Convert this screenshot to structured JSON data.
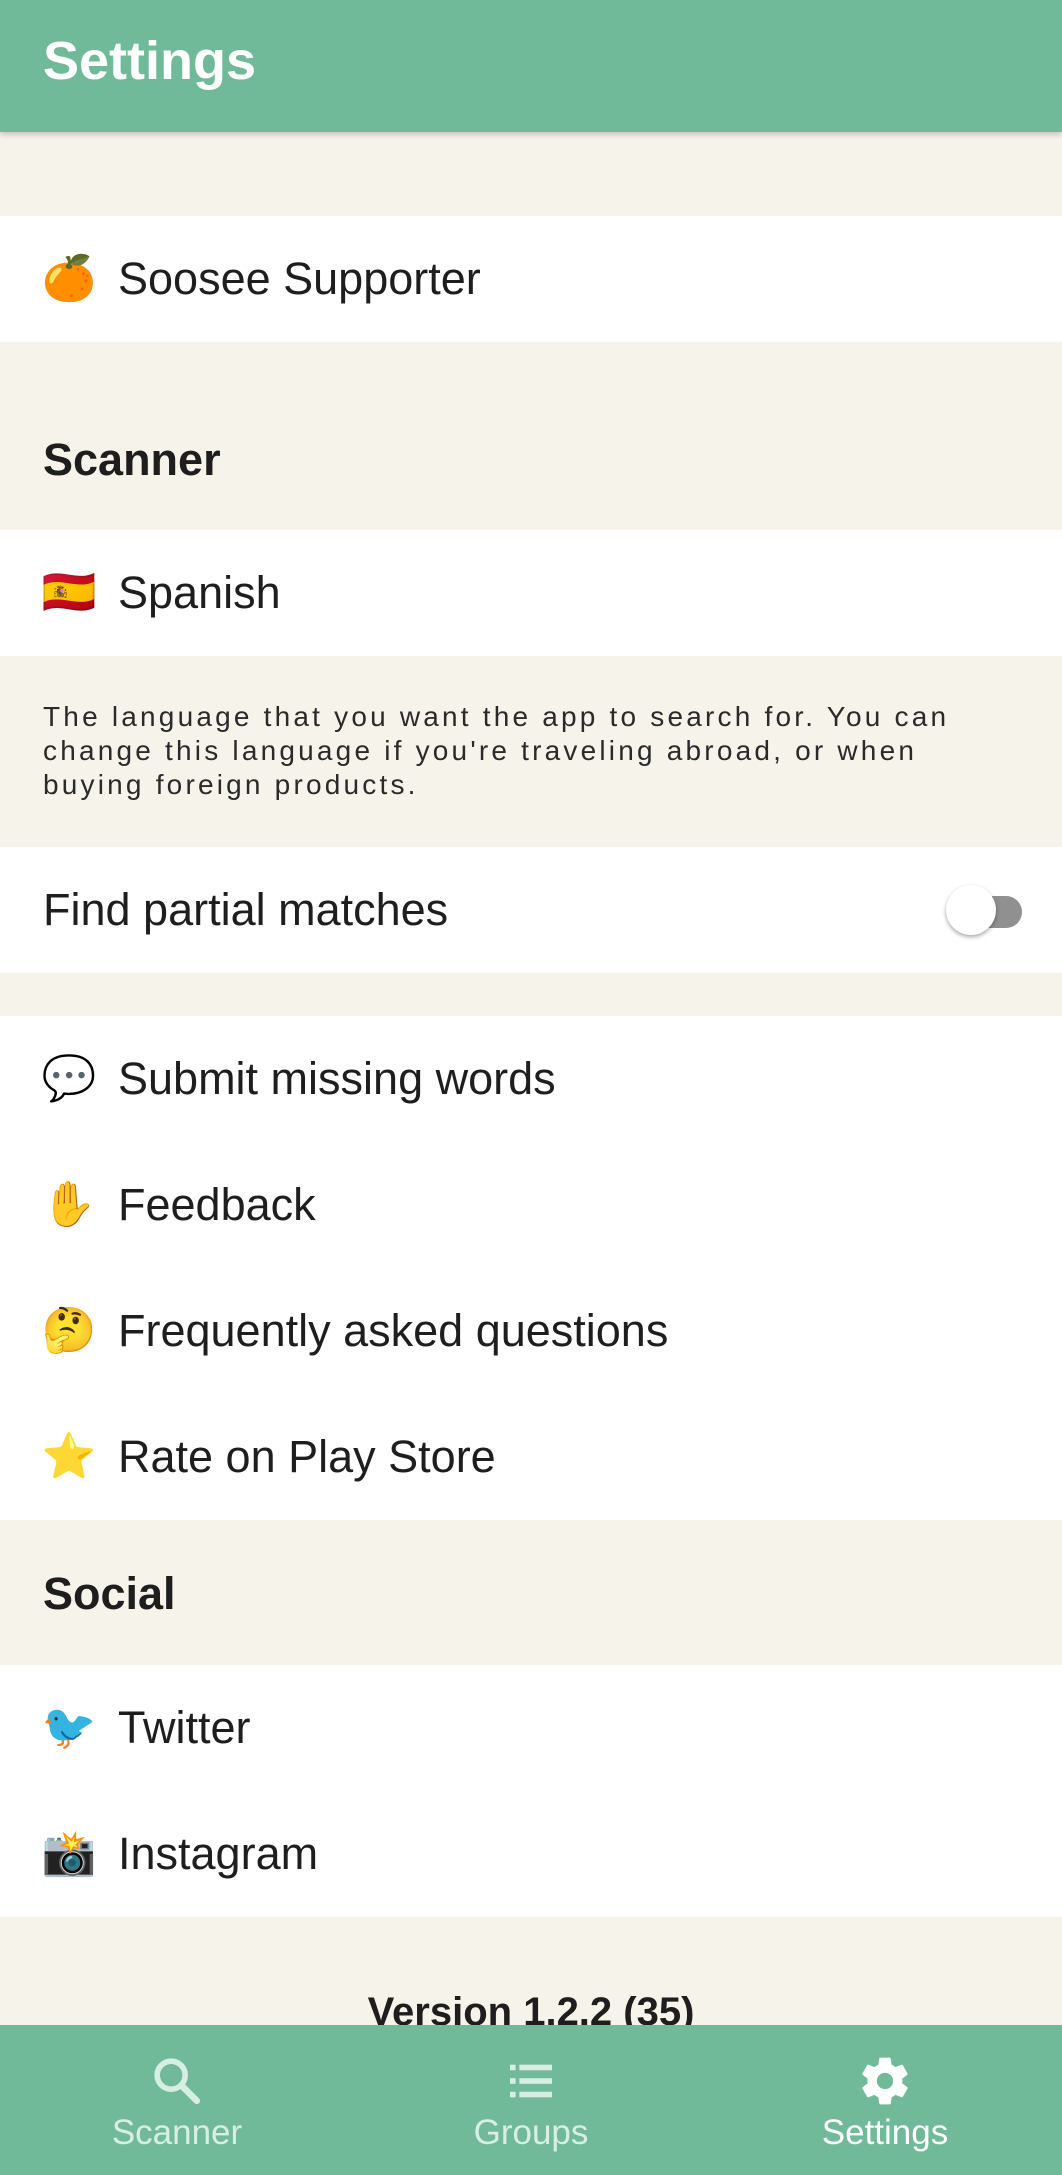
{
  "app_bar": {
    "title": "Settings"
  },
  "supporter": {
    "icon": "orange-icon",
    "emoji": "🍊",
    "label": "Soosee Supporter"
  },
  "scanner_section": {
    "header": "Scanner",
    "language": {
      "icon": "spain-flag-icon",
      "emoji": "🇪🇸",
      "label": "Spanish"
    },
    "description": "The language that you want the app to search for. You can change this language if you're traveling abroad, or when buying foreign products.",
    "partial_matches": {
      "label": "Find partial matches",
      "enabled": false
    }
  },
  "links": [
    {
      "icon": "speech-bubble-icon",
      "emoji": "💬",
      "label": "Submit missing words"
    },
    {
      "icon": "raised-hand-icon",
      "emoji": "✋",
      "label": "Feedback"
    },
    {
      "icon": "thinking-face-icon",
      "emoji": "🤔",
      "label": "Frequently asked questions"
    },
    {
      "icon": "star-icon",
      "emoji": "⭐",
      "label": "Rate on Play Store"
    }
  ],
  "social_section": {
    "header": "Social",
    "items": [
      {
        "icon": "bird-icon",
        "emoji": "🐦",
        "label": "Twitter"
      },
      {
        "icon": "camera-flash-icon",
        "emoji": "📸",
        "label": "Instagram"
      }
    ]
  },
  "version": "Version 1.2.2 (35)",
  "bottom_nav": [
    {
      "icon": "search-icon",
      "label": "Scanner",
      "active": false
    },
    {
      "icon": "list-icon",
      "label": "Groups",
      "active": false
    },
    {
      "icon": "gear-icon",
      "label": "Settings",
      "active": true
    }
  ],
  "colors": {
    "primary": "#70ba9a",
    "background": "#f6f3eb",
    "toggle_track_off": "#909090"
  }
}
